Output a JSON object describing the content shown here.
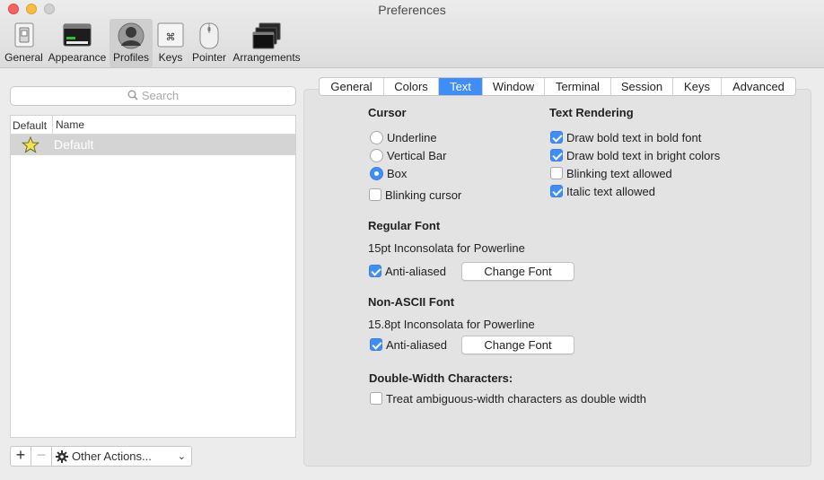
{
  "window": {
    "title": "Preferences"
  },
  "toolbar": {
    "items": [
      {
        "label": "General",
        "icon": "switch-icon"
      },
      {
        "label": "Appearance",
        "icon": "window-icon"
      },
      {
        "label": "Profiles",
        "icon": "person-icon",
        "active": true
      },
      {
        "label": "Keys",
        "icon": "command-key-icon"
      },
      {
        "label": "Pointer",
        "icon": "mouse-icon"
      },
      {
        "label": "Arrangements",
        "icon": "windows-stack-icon"
      }
    ]
  },
  "profiles": {
    "search_placeholder": "Search",
    "columns": {
      "default": "Default",
      "name": "Name"
    },
    "rows": [
      {
        "name": "Default",
        "is_default": true
      }
    ],
    "add_label": "+",
    "remove_label": "−",
    "actions_label": "Other Actions..."
  },
  "tabs": [
    {
      "label": "General"
    },
    {
      "label": "Colors"
    },
    {
      "label": "Text",
      "active": true
    },
    {
      "label": "Window"
    },
    {
      "label": "Terminal"
    },
    {
      "label": "Session"
    },
    {
      "label": "Keys"
    },
    {
      "label": "Advanced"
    }
  ],
  "cursor": {
    "title": "Cursor",
    "options": [
      {
        "label": "Underline",
        "selected": false
      },
      {
        "label": "Vertical Bar",
        "selected": false
      },
      {
        "label": "Box",
        "selected": true
      }
    ],
    "blinking": {
      "label": "Blinking cursor",
      "checked": false
    }
  },
  "text_rendering": {
    "title": "Text Rendering",
    "options": [
      {
        "label": "Draw bold text in bold font",
        "checked": true
      },
      {
        "label": "Draw bold text in bright colors",
        "checked": true
      },
      {
        "label": "Blinking text allowed",
        "checked": false
      },
      {
        "label": "Italic text allowed",
        "checked": true
      }
    ]
  },
  "regular_font": {
    "title": "Regular Font",
    "font": "15pt Inconsolata for Powerline",
    "anti_aliased": {
      "label": "Anti-aliased",
      "checked": true
    },
    "change_label": "Change Font"
  },
  "non_ascii_font": {
    "title": "Non-ASCII Font",
    "font": "15.8pt Inconsolata for Powerline",
    "anti_aliased": {
      "label": "Anti-aliased",
      "checked": true
    },
    "change_label": "Change Font"
  },
  "double_width": {
    "title": "Double-Width Characters:",
    "option": {
      "label": "Treat ambiguous-width characters as double width",
      "checked": false
    }
  },
  "colors": {
    "accent": "#3f8df6",
    "close": "#fc605c",
    "minimize": "#fdbc40"
  }
}
